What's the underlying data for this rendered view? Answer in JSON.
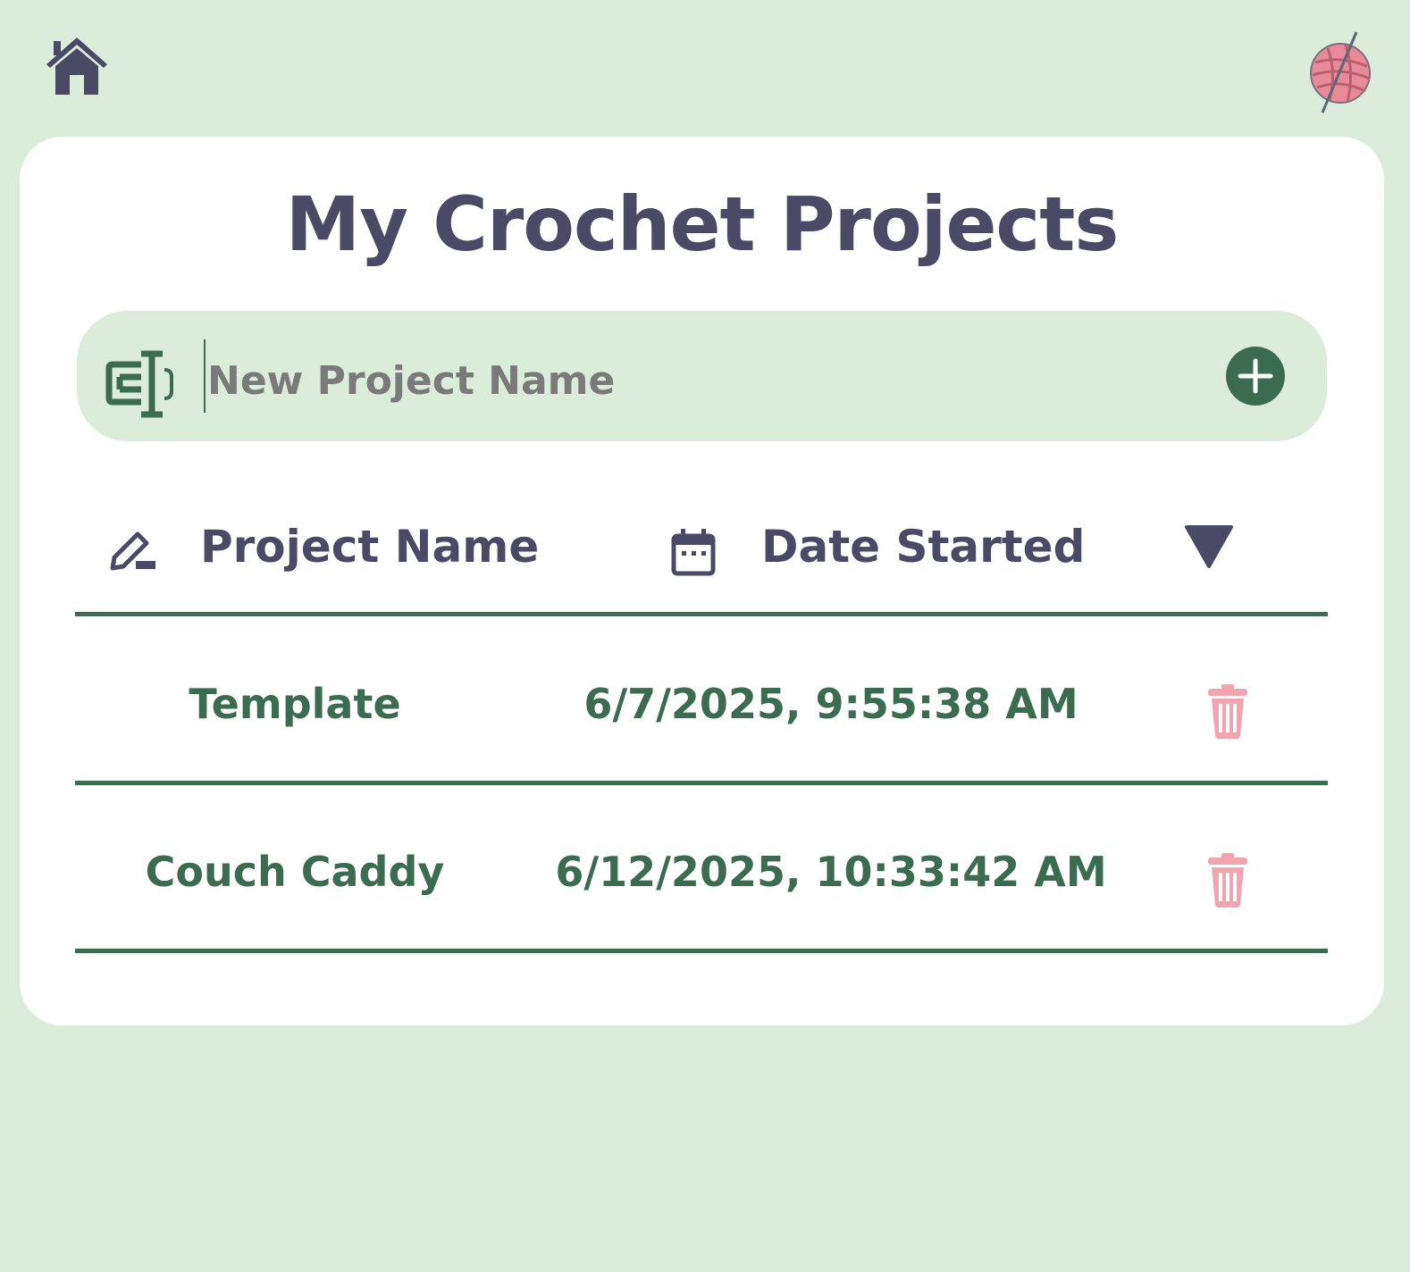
{
  "header": {
    "home_icon": "home-icon",
    "logo_icon": "yarn-ball-icon"
  },
  "colors": {
    "background": "#dcecdb",
    "card": "#ffffff",
    "title_text": "#4a4a66",
    "accent_green": "#3b6b50",
    "delete_pink": "#f0a5b1",
    "yarn_pink": "#e98a98"
  },
  "page": {
    "title": "My Crochet Projects"
  },
  "new_project": {
    "icon": "text-input-icon",
    "placeholder": "New Project Name",
    "value": "",
    "add_icon": "plus-circle-icon"
  },
  "table": {
    "columns": [
      {
        "label": "Project Name",
        "icon": "pencil-icon"
      },
      {
        "label": "Date Started",
        "icon": "calendar-icon"
      }
    ],
    "sort_icon": "triangle-down-icon",
    "rows": [
      {
        "name": "Template",
        "date": "6/7/2025, 9:55:38 AM",
        "action_icon": "trash-icon"
      },
      {
        "name": "Couch Caddy",
        "date": "6/12/2025, 10:33:42 AM",
        "action_icon": "trash-icon"
      }
    ]
  }
}
